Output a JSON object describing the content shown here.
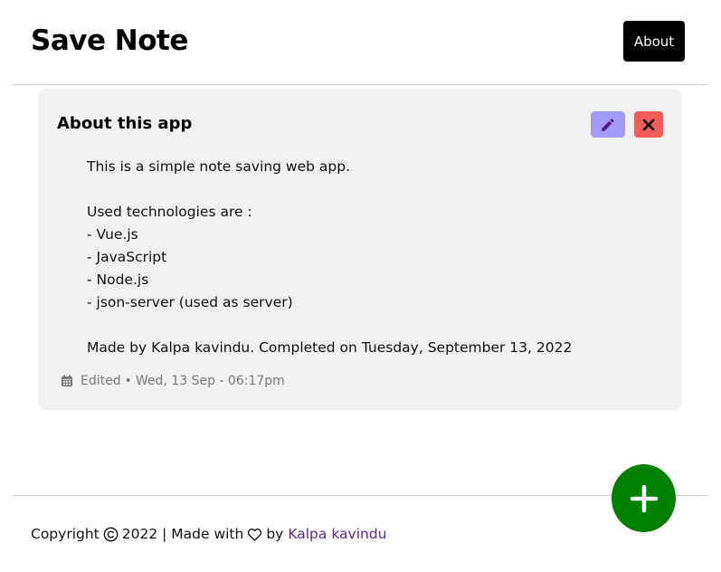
{
  "header": {
    "title": "Save Note",
    "about_label": "About"
  },
  "note": {
    "title": "About this app",
    "body_lines": [
      "This is a simple note saving web app.",
      "",
      "Used technologies are :",
      "- Vue.js",
      "- JavaScript",
      "- Node.js",
      "- json-server (used as server)",
      "",
      "Made by Kalpa kavindu. Completed on Tuesday, September 13, 2022"
    ],
    "status": "Edited",
    "separator": "•",
    "timestamp": "Wed, 13 Sep - 06:17pm",
    "icons": {
      "edit": "pencil-icon",
      "delete": "close-icon",
      "meta": "calendar-icon"
    }
  },
  "fab": {
    "icon": "plus-icon"
  },
  "footer": {
    "prefix": "Copyright",
    "year_text": "2022 | Made with",
    "by_text": "by",
    "author": "Kalpa kavindu",
    "icons": [
      "copyright-icon",
      "heart-icon"
    ]
  },
  "colors": {
    "edit_button": "#a59bf7",
    "delete_button": "#f35b5b",
    "fab": "#008000",
    "card_background": "#f0f0f0",
    "author_link": "#5b2a86"
  }
}
